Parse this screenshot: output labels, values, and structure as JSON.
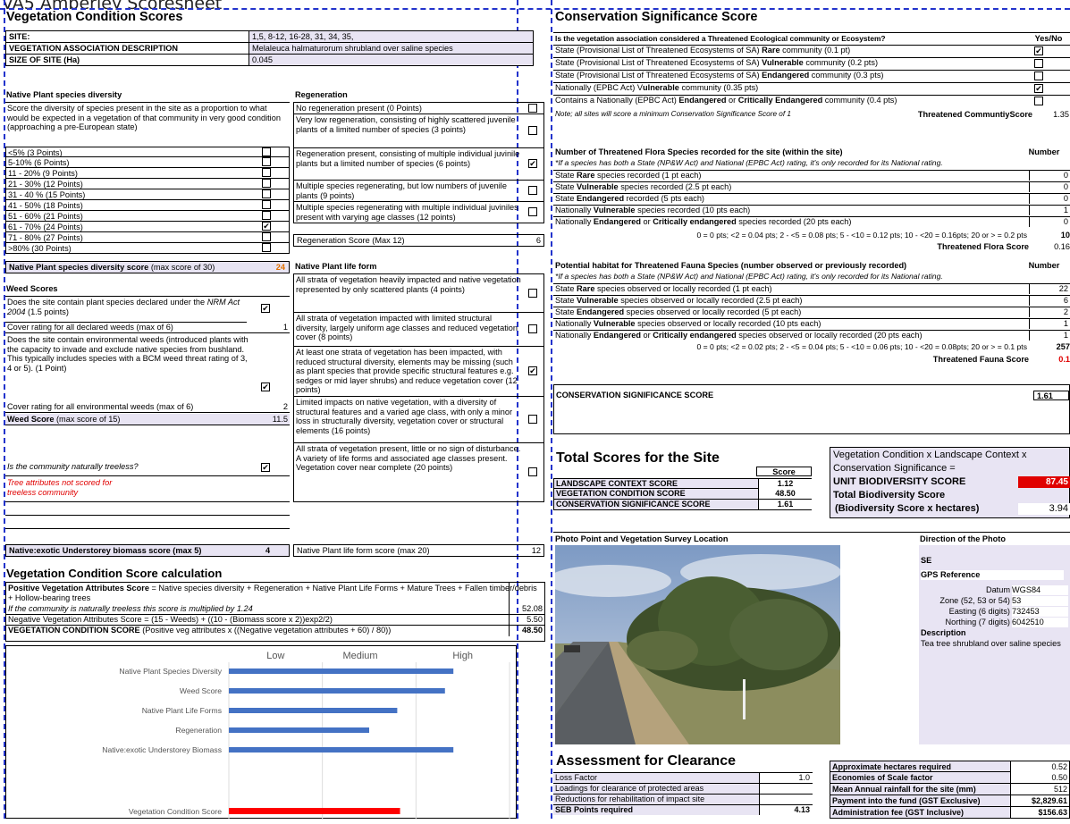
{
  "caption": "VA5 Amberley Scoresheet",
  "veg": {
    "title": "Vegetation Condition Scores",
    "site_label": "SITE:",
    "site_val": "1,5,  8-12, 16-28, 31, 34, 35,",
    "assoc_label": "VEGETATION ASSOCIATION DESCRIPTION",
    "assoc_val": "Melaleuca halmaturorum shrubland over saline species",
    "size_label": "SIZE OF SITE (Ha)",
    "size_val": "0.045"
  },
  "native": {
    "title": "Native Plant species diversity",
    "desc": "Score the diversity of species present in the site as a proportion to what would be expected in a vegetation of that community in very good condition (approaching a pre-European state)",
    "options": [
      {
        "label": "<5% (3 Points)",
        "checked": ""
      },
      {
        "label": "5-10% (6 Points)",
        "checked": ""
      },
      {
        "label": "11 - 20% (9 Points)",
        "checked": ""
      },
      {
        "label": "21 - 30% (12 Points)",
        "checked": ""
      },
      {
        "label": "31 - 40 % (15 Points)",
        "checked": ""
      },
      {
        "label": "41 - 50% (18 Points)",
        "checked": ""
      },
      {
        "label": "51 - 60% (21 Points)",
        "checked": ""
      },
      {
        "label": "61 - 70% (24 Points)",
        "checked": "✔"
      },
      {
        "label": "71 - 80% (27 Points)",
        "checked": ""
      },
      {
        "label": ">80% (30 Points)",
        "checked": ""
      }
    ],
    "score_label": "Native Plant species diversity score",
    "score_max": " (max score of 30)",
    "score_val": "24"
  },
  "regen": {
    "title": "Regeneration",
    "options": [
      {
        "label": "No regeneration present (0 Points)",
        "checked": ""
      },
      {
        "label": "Very low regeneration, consisting of highly scattered juvenile plants of a limited number of species (3 points)",
        "checked": ""
      },
      {
        "label": "Regeneration present, consisting of multiple individual juvinile plants but a limited number of species (6 points)",
        "checked": "✔"
      },
      {
        "label": "Multiple species regenerating, but low numbers of juvenile plants (9 points)",
        "checked": ""
      },
      {
        "label": "Multiple species regenerating with multiple individual juviniles present with varying age classes (12 points)",
        "checked": ""
      }
    ],
    "score_label": "Regeneration Score (Max 12)",
    "score_val": "6"
  },
  "weed": {
    "title": "Weed Scores",
    "q1a": "Does the site contain plant species declared under the ",
    "q1b": "NRM Act 2004",
    "q1c": " (1.5 points)",
    "q1_checked": "✔",
    "cover1_label": "Cover rating for all declared weeds (max of 6)",
    "cover1_val": "1",
    "q2": "Does the site contain environmental weeds (introduced plants with the capacity to invade and exclude native species from bushland. This typically includes species with a BCM weed threat rating of 3, 4 or 5). (1 Point)",
    "q2_checked": "✔",
    "cover2_label": "Cover rating for all environmental weeds (max of 6)",
    "cover2_val": "2",
    "score_label": "Weed Score",
    "score_max": " (max score of 15)",
    "score_val": "11.5",
    "treeless_q": "Is the community naturally treeless?",
    "treeless_checked": "✔",
    "treeless_note": "Tree attributes not scored for treeless community",
    "biomass_label": "Native:exotic Understorey biomass score (max 5)",
    "biomass_val": "4"
  },
  "lifeform": {
    "title": "Native Plant life form",
    "options": [
      {
        "label": "All strata of vegetation heavily impacted and native vegetation represented by only scattered plants (4 points)",
        "checked": ""
      },
      {
        "label": "All strata of vegetation impacted with limited structural diversity, largely uniform age classes and reduced vegetation cover (8 points)",
        "checked": ""
      },
      {
        "label": "At least one strata of  vegetation has been impacted, with reduced structural diversity, elements may be missing (such as plant species that provide specific structural features e.g. sedges or mid layer shrubs) and reduce vegetation cover (12 points)",
        "checked": "✔"
      },
      {
        "label": "Limited impacts on native vegetation, with a diversity of structural features and a varied age class, with only a minor loss in structurally diversity, vegetation cover or structural elements (16 points)",
        "checked": ""
      },
      {
        "label": "All strata of vegetation present, little or no sign of disturbance. A variety of life forms and associated age classes present. Vegetation cover near complete (20 points)",
        "checked": ""
      }
    ],
    "score_label": "Native Plant life form score (max 20)",
    "score_val": "12"
  },
  "calc": {
    "title": "Vegetation Condition Score calculation",
    "pos_label": "Positive Vegetation Attributes Score",
    "pos_text": " = Native species diversity + Regeneration + Native Plant Life Forms + Mature Trees + Fallen timber/debris + Hollow-bearing trees",
    "pos_note": "If the community is naturally treeless this score is multiplied by 1.24",
    "pos_val": "52.08",
    "neg_text": "Negative Vegetation Attributes Score = (15 - Weeds) + ((10 - (Biomass score x 2))exp2/2)",
    "neg_val": "5.50",
    "vcs_label": "VEGETATION CONDITION SCORE",
    "vcs_text": " (Positive veg attributes x ((Negative vegetation attributes + 60) / 80))",
    "vcs_val": "48.50"
  },
  "chart_data": {
    "type": "bar",
    "orientation": "horizontal",
    "levels": [
      "Low",
      "Medium",
      "High"
    ],
    "categories": [
      "Native Plant Species Diversity",
      "Weed Score",
      "Native Plant Life Forms",
      "Regeneration",
      "Native:exotic Understorey Biomass"
    ],
    "values": [
      0.8,
      0.77,
      0.6,
      0.5,
      0.8
    ],
    "colors": {
      "bars": "#4472c4",
      "score": "#ff0000"
    },
    "score_label": "Vegetation Condition Score",
    "score_value": 0.61
  },
  "cons": {
    "title": "Conservation Significance Score",
    "q_head": "Is the vegetation association considered a Threatened Ecological community or Ecosystem?",
    "yn_head": "Yes/No",
    "rows": [
      {
        "a": "State (Provisional List of Threatened Ecosystems of SA) ",
        "b": "Rare",
        "c": " community (0.1 pt)",
        "d": "",
        "e": "",
        "checked": "✔"
      },
      {
        "a": "State (Provisional List of Threatened Ecosystems of SA) ",
        "b": "Vulnerable",
        "c": " community (0.2 pts)",
        "d": "",
        "e": "",
        "checked": ""
      },
      {
        "a": "State (Provisional List of Threatened Ecosystems of SA) ",
        "b": "Endangered",
        "c": " community (0.3 pts)",
        "d": "",
        "e": "",
        "checked": ""
      },
      {
        "a": "Nationally (EPBC Act) V",
        "b": "ulnerable",
        "c": " community (0.35 pts)",
        "d": "",
        "e": "",
        "checked": "✔"
      },
      {
        "a": "Contains a Nationally (EPBC Act) ",
        "b": "Endangered",
        "c": " or ",
        "d": "Critically Endangered",
        "e": " community (0.4 pts)",
        "checked": ""
      }
    ],
    "note": "Note; all sites will score a minimum Conservation Significance Score of 1",
    "tc_label": "Threatened CommuntiyScore",
    "tc_val": "1.35",
    "flora_head": "Number of Threatened Flora Species recorded for the site (within the site)",
    "number": "Number",
    "flora_note": "*If a species has both a State (NP&W Act) and National (EPBC Act) rating, it's only recorded for its National rating.",
    "flora": [
      {
        "a": "State ",
        "b": "Rare",
        "c": " species recorded (1 pt each)",
        "d": "",
        "e": "",
        "v": "0"
      },
      {
        "a": "State ",
        "b": "Vulnerable",
        "c": " species recorded (2.5 pt each)",
        "d": "",
        "e": "",
        "v": "0"
      },
      {
        "a": "State ",
        "b": "Endangered",
        "c": " recorded (5 pts each)",
        "d": "",
        "e": "",
        "v": "0"
      },
      {
        "a": "Nationally ",
        "b": "Vulnerable",
        "c": " species recorded (10 pts each)",
        "d": "",
        "e": "",
        "v": "1"
      },
      {
        "a": "Nationally ",
        "b": "Endangered",
        "c": " or ",
        "d": "Critically endangered",
        "e": " species recorded (20 pts each)",
        "v": "0"
      }
    ],
    "flora_formula": "0 = 0 pts; <2 = 0.04 pts; 2 - <5 = 0.08 pts; 5 - <10 = 0.12 pts; 10 - <20 = 0.16pts; 20 or > = 0.2 pts",
    "flora_total": "10",
    "flora_score_label": "Threatened Flora Score",
    "flora_score_val": "0.16",
    "fauna_head": "Potential habitat for Threatened Fauna Species (number observed or previously recorded)",
    "fauna": [
      {
        "a": "State ",
        "b": "Rare",
        "c": " species observed or locally recorded (1 pt each)",
        "d": "",
        "e": "",
        "v": "22"
      },
      {
        "a": "State ",
        "b": "Vulnerable",
        "c": " species observed or locally recorded (2.5 pt each)",
        "d": "",
        "e": "",
        "v": "6"
      },
      {
        "a": "State ",
        "b": "Endangered",
        "c": " species observed or locally recorded  (5 pt each)",
        "d": "",
        "e": "",
        "v": "2"
      },
      {
        "a": "Nationally ",
        "b": "Vulnerable",
        "c": " species observed or locally recorded (10 pts each)",
        "d": "",
        "e": "",
        "v": "1"
      },
      {
        "a": "Nationally ",
        "b": "Endangered",
        "c": " or ",
        "d": "Critically endangered",
        "e": " species observed or locally recorded (20 pts each)",
        "v": "1"
      }
    ],
    "fauna_formula": "0 = 0 pts; <2 = 0.02 pts; 2 - <5 = 0.04 pts; 5 - <10 = 0.06 pts; 10 - <20 = 0.08pts; 20 or > = 0.1 pts",
    "fauna_total": "257",
    "fauna_score_label": "Threatened Fauna Score",
    "fauna_score_val": "0.1",
    "css_label": "CONSERVATION SIGNIFICANCE SCORE",
    "css_val": "1.61"
  },
  "totals": {
    "title": "Total Scores for the Site",
    "score_head": "Score",
    "rows": [
      {
        "label": "LANDSCAPE CONTEXT SCORE",
        "val": "1.12"
      },
      {
        "label": "VEGETATION CONDITION SCORE",
        "val": "48.50"
      },
      {
        "label": "CONSERVATION SIGNIFICANCE SCORE",
        "val": "1.61"
      }
    ],
    "formula1": "Vegetation Condition x Landscape Context x",
    "formula2": "Conservation Significance =",
    "ubs_label": "UNIT BIODIVERSITY SCORE",
    "ubs_val": "87.45",
    "tbs_label1": "Total Biodiversity Score",
    "tbs_label2": "(Biodiversity Score x hectares)",
    "tbs_val": "3.94"
  },
  "photo": {
    "title": "Photo Point and Vegetation Survey Location",
    "dir_head": "Direction of the Photo",
    "dir_val": "SE",
    "gps_head": "GPS Reference",
    "datum_label": "Datum",
    "datum_val": "WGS84",
    "zone_label": "Zone (52, 53 or 54)",
    "zone_val": "53",
    "easting_label": "Easting (6 digits)",
    "easting_val": "732453",
    "northing_label": "Northing (7 digits)",
    "northing_val": "6042510",
    "desc_head": "Description",
    "desc_val": "Tea tree shrubland over saline species"
  },
  "clear": {
    "title": "Assessment for Clearance",
    "rows": [
      {
        "label": "Loss Factor",
        "val": "1.0"
      },
      {
        "label": "Loadings for clearance of protected areas",
        "val": ""
      },
      {
        "label": "Reductions for rehabilitation of impact site",
        "val": ""
      },
      {
        "label": "SEB Points required",
        "val": "4.13"
      }
    ],
    "right": [
      {
        "label": "Approximate hectares required",
        "val": "0.52"
      },
      {
        "label": "Economies of Scale factor",
        "val": "0.50"
      },
      {
        "label": "Mean Annual rainfall for the site (mm)",
        "val": "512"
      },
      {
        "label": "Payment into the fund (GST Exclusive)",
        "val": "$2,829.61"
      },
      {
        "label": "Administration fee (GST Inclusive)",
        "val": "$156.63"
      }
    ]
  }
}
